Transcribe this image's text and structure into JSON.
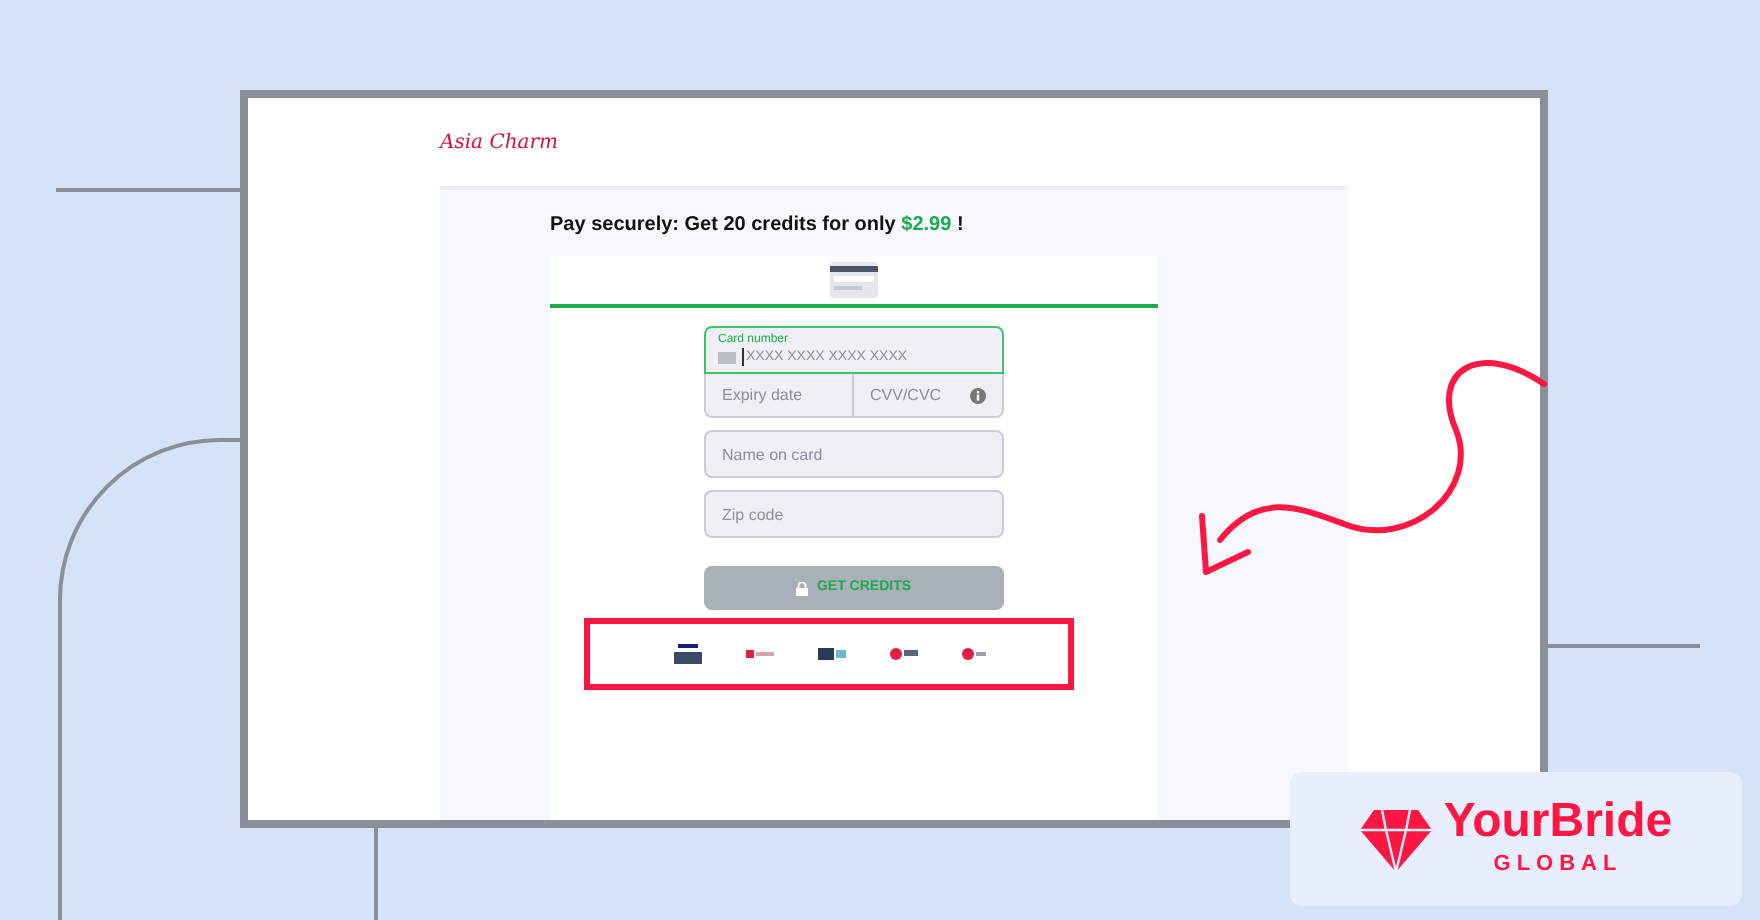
{
  "logo": "Asia Charm",
  "title": {
    "prefix": "Pay securely: Get 20 credits for only ",
    "price": "$2.99",
    "suffix": " !"
  },
  "form": {
    "card_number": {
      "label": "Card number",
      "placeholder": "XXXX XXXX XXXX XXXX"
    },
    "expiry": {
      "placeholder": "Expiry date"
    },
    "cvv": {
      "placeholder": "CVV/CVC"
    },
    "name": {
      "placeholder": "Name on card"
    },
    "zip": {
      "placeholder": "Zip code"
    },
    "submit": {
      "label": "GET CREDITS",
      "disabled": true
    }
  },
  "brand": {
    "name": "YourBride",
    "tagline": "GLOBAL"
  }
}
